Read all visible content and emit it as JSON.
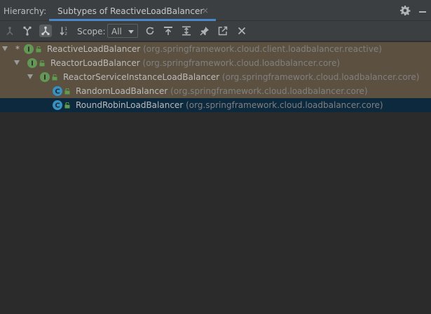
{
  "header": {
    "label": "Hierarchy:",
    "tab_title": "Subtypes of ReactiveLoadBalancer",
    "tab_close": "×"
  },
  "toolbar": {
    "scope_label": "Scope:",
    "scope_value": "All",
    "buttons": [
      "supertypes-icon",
      "subtypes-icon",
      "class-hierarchy-icon",
      "sort-alphabetically-icon",
      "refresh-icon",
      "autoscroll-to-source-icon",
      "expand-all-icon",
      "pin-icon",
      "open-in-new-window-icon",
      "close-icon"
    ]
  },
  "tree": {
    "items": [
      {
        "star": "*",
        "kind": "I",
        "name": "ReactiveLoadBalancer",
        "pkg": "(org.springframework.cloud.client.loadbalancer.reactive)"
      },
      {
        "kind": "I",
        "name": "ReactorLoadBalancer",
        "pkg": "(org.springframework.cloud.loadbalancer.core)"
      },
      {
        "kind": "I",
        "name": "ReactorServiceInstanceLoadBalancer",
        "pkg": "(org.springframework.cloud.loadbalancer.core)"
      },
      {
        "kind": "C",
        "name": "RandomLoadBalancer",
        "pkg": "(org.springframework.cloud.loadbalancer.core)"
      },
      {
        "kind": "C",
        "name": "RoundRobinLoadBalancer",
        "pkg": "(org.springframework.cloud.loadbalancer.core)"
      }
    ]
  },
  "colors": {
    "interface_icon": "#629755",
    "class_icon": "#3592c4",
    "highlight_row": "#5c5140",
    "selected_row": "#0d293e",
    "tab_underline": "#4a88c7"
  }
}
